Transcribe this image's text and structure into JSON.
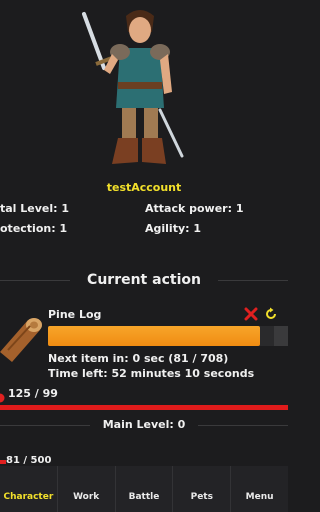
{
  "character": {
    "name": "testAccount",
    "stats": {
      "total_level": "tal Level: 1",
      "attack_power": "Attack power: 1",
      "protection": "otection: 1",
      "agility": "Agility: 1"
    }
  },
  "current_action": {
    "title": "Current action",
    "item_name": "Pine Log",
    "next_item": "Next item in: 0 sec (81 / 708)",
    "time_left": "Time left: 52 minutes 10 seconds",
    "progress_fraction": 0.94,
    "resource_count": "125 / 99"
  },
  "main_level": {
    "label": "Main Level: 0",
    "xp": "81 / 500"
  },
  "nav": {
    "items": [
      {
        "label": "Character",
        "active": true
      },
      {
        "label": "Work",
        "active": false
      },
      {
        "label": "Battle",
        "active": false
      },
      {
        "label": "Pets",
        "active": false
      },
      {
        "label": "Menu",
        "active": false
      }
    ]
  },
  "colors": {
    "accent": "#f2e02b",
    "progress": "#f39a1c",
    "danger": "#e01b1b",
    "background": "#1c1c1e"
  },
  "icons": [
    "hero-portrait",
    "pine-log-icon",
    "close-icon",
    "refresh-icon",
    "heart-icon"
  ]
}
